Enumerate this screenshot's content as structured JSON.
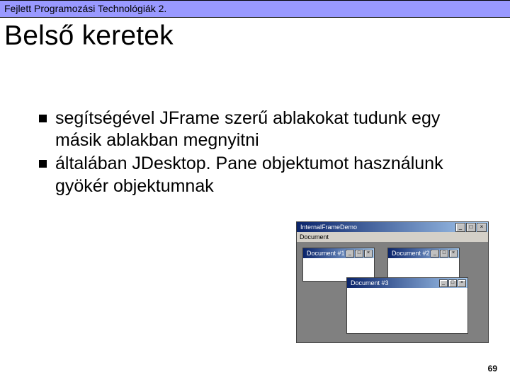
{
  "header": {
    "text": "Fejlett Programozási Technológiák 2."
  },
  "title": "Belső keretek",
  "bullets": [
    "segítségével JFrame szerű ablakokat tudunk egy másik ablakban megnyitni",
    "általában JDesktop. Pane objektumot használunk gyökér objektumnak"
  ],
  "page_number": "69",
  "shot": {
    "main_title": "InternalFrameDemo",
    "menu": "Document",
    "btn_min": "_",
    "btn_max": "□",
    "btn_close": "×",
    "frames": [
      {
        "title": "Document #1"
      },
      {
        "title": "Document #2"
      },
      {
        "title": "Document #3"
      }
    ]
  }
}
